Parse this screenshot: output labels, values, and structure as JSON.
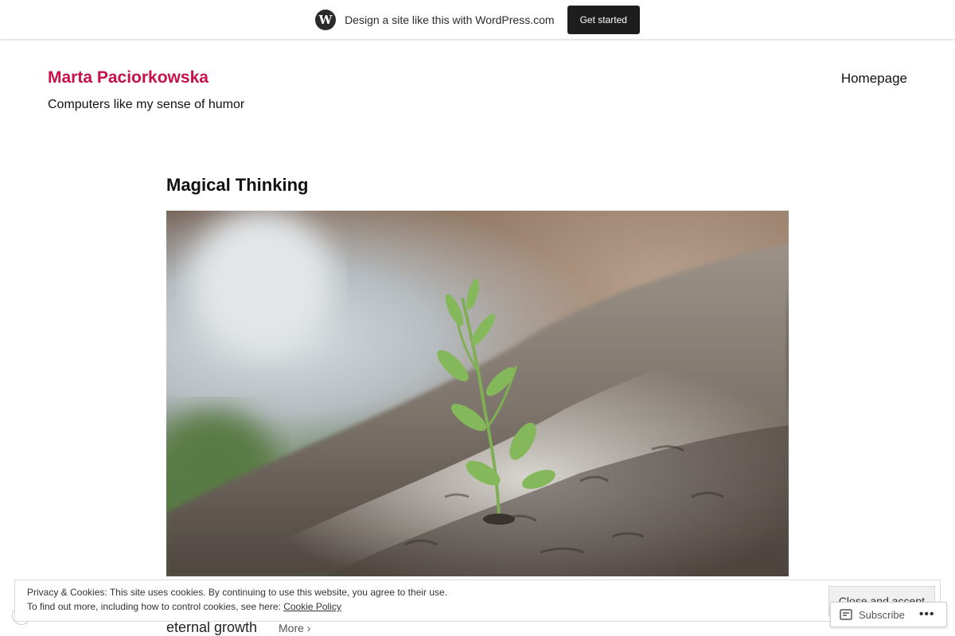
{
  "wpbar": {
    "logo_glyph": "W",
    "text": "Design a site like this with WordPress.com",
    "button": "Get started"
  },
  "header": {
    "site_title": "Marta Paciorkowska",
    "tagline": "Computers like my sense of humor",
    "nav": [
      "Homepage"
    ]
  },
  "post": {
    "title": "Magical Thinking",
    "image_alt": "Small green sprout growing out of tree bark",
    "excerpt": "eternal growth",
    "more": "More ›"
  },
  "cookie": {
    "line1": "Privacy & Cookies: This site uses cookies. By continuing to use this website, you agree to their use.",
    "line2_prefix": "To find out more, including how to control cookies, see here: ",
    "policy_link": "Cookie Policy",
    "close_button": "Close and accept"
  },
  "follow": {
    "subscribe": "Subscribe",
    "more_dots": "•••"
  },
  "colors": {
    "brand": "#c8104a",
    "wp_dark": "#1d1d1d"
  }
}
